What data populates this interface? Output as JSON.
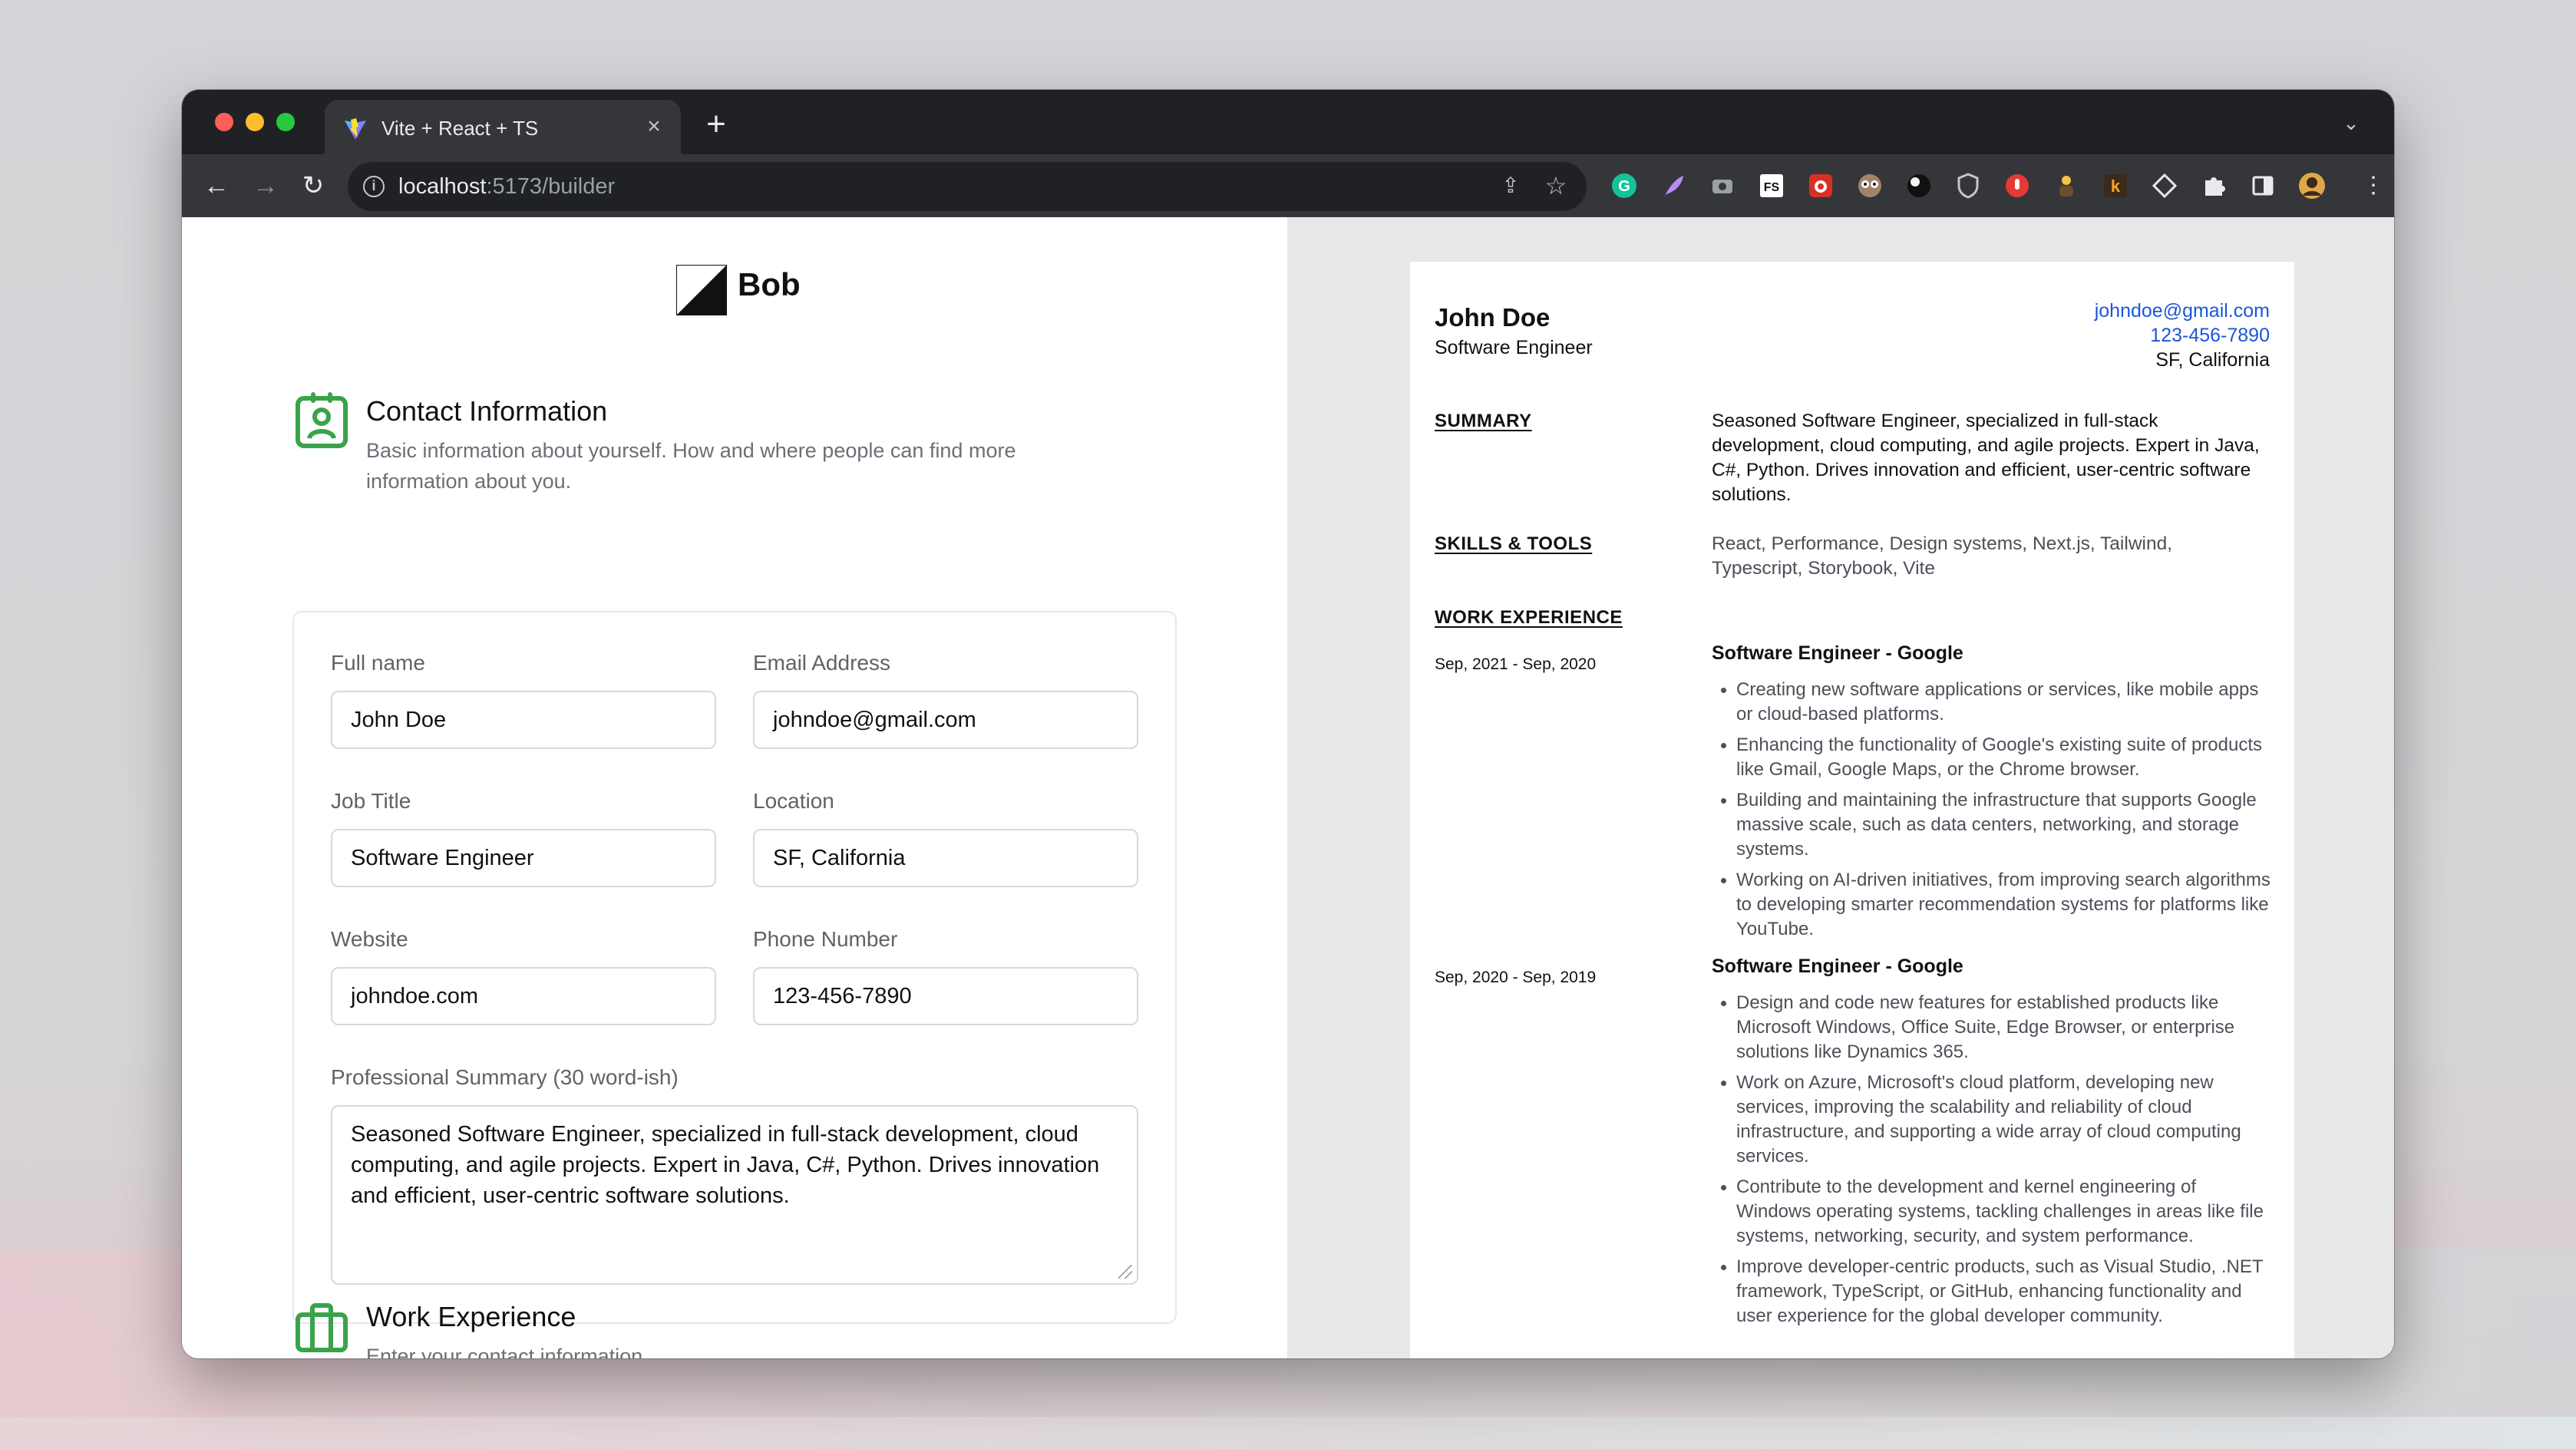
{
  "browser": {
    "tab_title": "Vite + React + TS",
    "url_host": "localhost",
    "url_path": ":5173/builder",
    "close_glyph": "×",
    "newtab_glyph": "+",
    "tabs_menu_glyph": "⌄",
    "back_glyph": "←",
    "forward_glyph": "→",
    "reload_glyph": "↻",
    "info_glyph": "i",
    "share_glyph": "⇪",
    "star_glyph": "☆",
    "menu_glyph": "⋮",
    "extensions": [
      "grammarly-icon",
      "feather-icon",
      "camera-icon",
      "fs-icon",
      "bug-icon",
      "owl-icon",
      "ball-icon",
      "shield-icon",
      "record-icon",
      "figure-icon",
      "k-icon",
      "diamond-icon",
      "puzzle-icon",
      "sidepanel-icon",
      "profile-avatar"
    ],
    "colors": {
      "tabstrip": "#202124",
      "toolbar": "#35363a"
    }
  },
  "app": {
    "logo_text": "Bob",
    "contact_section": {
      "title": "Contact Information",
      "description": "Basic information about yourself. How and where people can find more information about you."
    },
    "fields": {
      "full_name": {
        "label": "Full name",
        "value": "John Doe"
      },
      "email": {
        "label": "Email Address",
        "value": "johndoe@gmail.com"
      },
      "job_title": {
        "label": "Job Title",
        "value": "Software Engineer"
      },
      "location": {
        "label": "Location",
        "value": "SF, California"
      },
      "website": {
        "label": "Website",
        "value": "johndoe.com"
      },
      "phone": {
        "label": "Phone Number",
        "value": "123-456-7890"
      },
      "summary": {
        "label": "Professional Summary (30 word-ish)",
        "value": "Seasoned Software Engineer, specialized in full-stack development, cloud computing, and agile projects. Expert in Java, C#, Python. Drives innovation and efficient, user-centric software solutions."
      }
    },
    "work_section": {
      "title": "Work Experience",
      "description": "Enter your contact information"
    },
    "accent_color": "#3aa34a"
  },
  "resume": {
    "name": "John Doe",
    "role": "Software Engineer",
    "email": "johndoe@gmail.com",
    "phone": "123-456-7890",
    "location": "SF, California",
    "link_color": "#1a56db",
    "summary_heading": "SUMMARY",
    "summary": "Seasoned Software Engineer, specialized in full-stack development, cloud computing, and agile projects. Expert in Java, C#, Python. Drives innovation and efficient, user-centric software solutions.",
    "skills_heading": "SKILLS & TOOLS",
    "skills": "React, Performance, Design systems, Next.js, Tailwind, Typescript, Storybook, Vite",
    "work_heading": "WORK EXPERIENCE",
    "jobs": [
      {
        "dates": "Sep, 2021 - Sep, 2020",
        "title": "Software Engineer - Google",
        "bullets": [
          "Creating new software applications or services, like mobile apps or cloud-based platforms.",
          "Enhancing the functionality of Google's existing suite of products like Gmail, Google Maps, or the Chrome browser.",
          "Building and maintaining the infrastructure that supports Google massive scale, such as data centers, networking, and storage systems.",
          "Working on AI-driven initiatives, from improving search algorithms to developing smarter recommendation systems for platforms like YouTube."
        ]
      },
      {
        "dates": "Sep, 2020 - Sep, 2019",
        "title": "Software Engineer - Google",
        "bullets": [
          "Design and code new features for established products like Microsoft Windows, Office Suite, Edge Browser, or enterprise solutions like Dynamics 365.",
          "Work on Azure, Microsoft's cloud platform, developing new services, improving the scalability and reliability of cloud infrastructure, and supporting a wide array of cloud computing services.",
          "Contribute to the development and kernel engineering of Windows operating systems, tackling challenges in areas like file systems, networking, security, and system performance.",
          "Improve developer-centric products, such as Visual Studio, .NET framework, TypeScript, or GitHub, enhancing functionality and user experience for the global developer community."
        ]
      }
    ]
  }
}
